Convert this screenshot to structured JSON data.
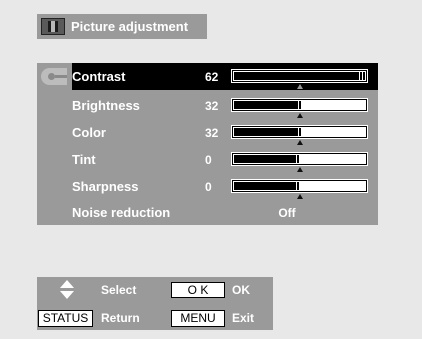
{
  "title": "Picture adjustment",
  "settings": [
    {
      "label": "Contrast",
      "value": "62",
      "level": 62,
      "max": 62,
      "selected": true,
      "bar": true
    },
    {
      "label": "Brightness",
      "value": "32",
      "level": 32,
      "max": 62,
      "selected": false,
      "bar": true
    },
    {
      "label": "Color",
      "value": "32",
      "level": 32,
      "max": 62,
      "selected": false,
      "bar": true
    },
    {
      "label": "Tint",
      "value": "0",
      "level": 0,
      "min": -31,
      "max": 31,
      "selected": false,
      "bar": true
    },
    {
      "label": "Sharpness",
      "value": "0",
      "level": 0,
      "min": -31,
      "max": 31,
      "selected": false,
      "bar": true
    },
    {
      "label": "Noise reduction",
      "value": "Off",
      "selected": false,
      "bar": false
    }
  ],
  "help": {
    "select_label": "Select",
    "ok_key": "O K",
    "ok_label": "OK",
    "status_key": "STATUS",
    "return_label": "Return",
    "menu_key": "MENU",
    "exit_label": "Exit"
  },
  "colors": {
    "background": "#e8e8e8",
    "panel": "#9a9a9a",
    "selected_row": "#000000",
    "text": "#ffffff"
  },
  "icons": {
    "title": "picture-icon",
    "selector": "hand-pointer-icon",
    "navigation": "up-down-arrows-icon"
  }
}
